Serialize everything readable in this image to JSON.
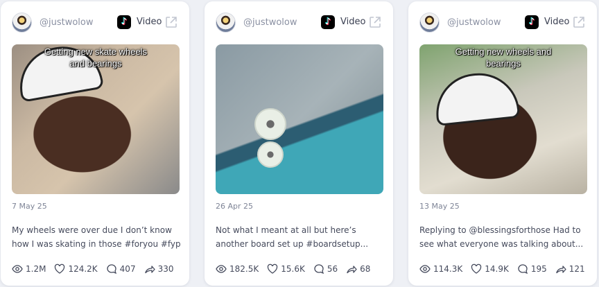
{
  "cards": [
    {
      "username": "@justwolow",
      "type_label": "Video",
      "caption": [
        "Getting new skate wheels",
        "and bearings"
      ],
      "date": "7 May 25",
      "description": [
        "My wheels were over due I don’t know",
        "how I was skating in those #foryou #fyp..."
      ],
      "stats": {
        "views": "1.2M",
        "likes": "124.2K",
        "comments": "407",
        "shares": "330"
      }
    },
    {
      "username": "@justwolow",
      "type_label": "Video",
      "caption": [
        "",
        ""
      ],
      "date": "26 Apr 25",
      "description": [
        "Not what I meant at all but here’s",
        "another board set up #boardsetup..."
      ],
      "stats": {
        "views": "182.5K",
        "likes": "15.6K",
        "comments": "56",
        "shares": "68"
      }
    },
    {
      "username": "@justwolow",
      "type_label": "Video",
      "caption": [
        "Getting new wheels and",
        "bearings"
      ],
      "date": "13 May 25",
      "description": [
        "Replying to @blessingsforthose Had to",
        "see what everyone was talking about..."
      ],
      "stats": {
        "views": "114.3K",
        "likes": "14.9K",
        "comments": "195",
        "shares": "121"
      }
    }
  ],
  "icons": {
    "platform": "tiktok-icon",
    "external": "external-link-icon",
    "views": "eye-icon",
    "likes": "heart-icon",
    "comments": "comment-icon",
    "shares": "share-icon"
  }
}
